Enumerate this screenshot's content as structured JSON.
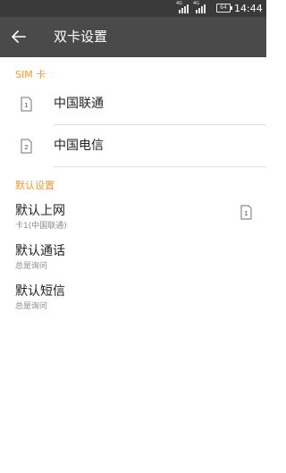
{
  "status_bar": {
    "net1": "4G",
    "net2": "4G",
    "battery": "64",
    "time": "14:44"
  },
  "app_bar": {
    "title": "双卡设置",
    "back_icon": "arrow-left-icon"
  },
  "sim_section": {
    "header": "SIM 卡",
    "items": [
      {
        "badge": "1",
        "label": "中国联通",
        "icon": "sim-card-icon"
      },
      {
        "badge": "2",
        "label": "中国电信",
        "icon": "sim-card-icon"
      }
    ]
  },
  "default_section": {
    "header": "默认设置",
    "items": [
      {
        "title": "默认上网",
        "subtitle": "卡1(中国联通)",
        "badge": "1",
        "icon": "sim-card-icon"
      },
      {
        "title": "默认通话",
        "subtitle": "总是询问"
      },
      {
        "title": "默认短信",
        "subtitle": "总是询问"
      }
    ]
  },
  "colors": {
    "accent": "#f29a2e",
    "app_bar": "#4a4a4a",
    "status_bar": "#3a3a3a"
  }
}
